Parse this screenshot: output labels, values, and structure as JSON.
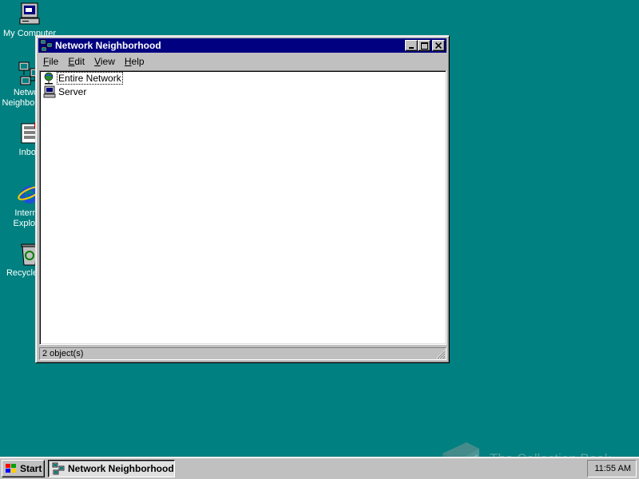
{
  "desktop": {
    "background_color": "#008080",
    "icons": [
      {
        "label": "My Computer",
        "icon": "my-computer-icon"
      },
      {
        "label": "Network Neighborhood",
        "icon": "network-neighborhood-icon"
      },
      {
        "label": "Inbox",
        "icon": "inbox-icon"
      },
      {
        "label": "Internet Explorer",
        "icon": "internet-explorer-icon"
      },
      {
        "label": "Recycle Bin",
        "icon": "recycle-bin-icon"
      }
    ]
  },
  "window": {
    "title": "Network Neighborhood",
    "title_bar_color": "#000080",
    "menu": [
      {
        "label": "File",
        "accel": "F",
        "rest": "ile"
      },
      {
        "label": "Edit",
        "accel": "E",
        "rest": "dit"
      },
      {
        "label": "View",
        "accel": "V",
        "rest": "iew"
      },
      {
        "label": "Help",
        "accel": "H",
        "rest": "elp"
      }
    ],
    "items": [
      {
        "label": "Entire Network",
        "icon": "entire-network-icon"
      },
      {
        "label": "Server",
        "icon": "server-computer-icon"
      }
    ],
    "status": "2 object(s)"
  },
  "taskbar": {
    "start_label": "Start",
    "tasks": [
      {
        "label": "Network Neighborhood",
        "icon": "network-neighborhood-icon"
      }
    ],
    "clock": "11:55 AM"
  },
  "watermark": {
    "text": "The Collection Book",
    "icon": "book-icon"
  }
}
